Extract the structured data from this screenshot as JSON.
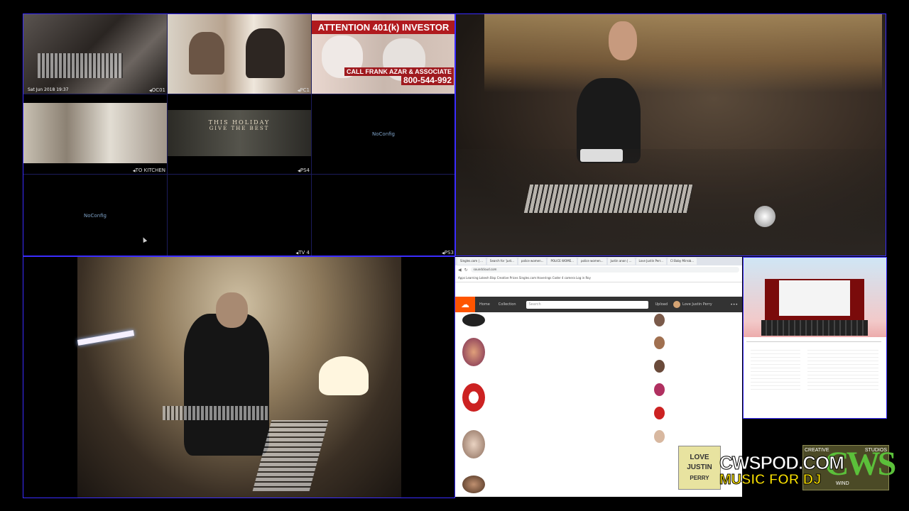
{
  "grid": {
    "cam1_label": "OC01",
    "cam1_overlay": "Sat Jun 2018 19:37",
    "cam2_label": "PC1",
    "cam4_label": "TO KITCHEN",
    "cam5_label": "PS4",
    "cam8_label": "TV 4",
    "cam9_label": "PS3",
    "noconfig_a": "NoConfig",
    "noconfig_b": "NoConfig",
    "ad_title": "ATTENTION 401(k) INVESTOR",
    "ad_call": "CALL FRANK AZAR & ASSOCIATE",
    "ad_phone": "800-544-992",
    "holiday_line1": "THIS HOLIDAY",
    "holiday_line2": "GIVE THE BEST"
  },
  "browser": {
    "tabs": [
      "Singles.com | ...",
      "Search for 'just...",
      "police women...",
      "POLICE WOME...",
      "police women...",
      "Justin anon | ...",
      "Love Justin Perr...",
      "CI Baby Mirrob..."
    ],
    "url": "soundcloud.com",
    "bookmarks": "Apps  Learning  Lokesh Bisp  Creative Prices  Singles.com  Hoverings  Coder  4 camera  Log in  Roy",
    "nav_home": "Home",
    "nav_collection": "Collection",
    "search_placeholder": "Search",
    "upload": "Upload",
    "user_name": "Love Justin Perry",
    "more": "•••"
  },
  "logo": {
    "cwspod": "CWSPOD.COM",
    "music_for_dj": "MUSIC FOR DJ",
    "love_line1": "LOVE",
    "love_line2": "JUSTIN",
    "love_line3": "PERRY",
    "cws": "CWS",
    "creative": "CREATIVE",
    "studios": "STUDIOS",
    "wind": "WIND"
  },
  "colors": {
    "border_accent": "#3a2cff",
    "soundcloud_orange": "#ff5500"
  }
}
